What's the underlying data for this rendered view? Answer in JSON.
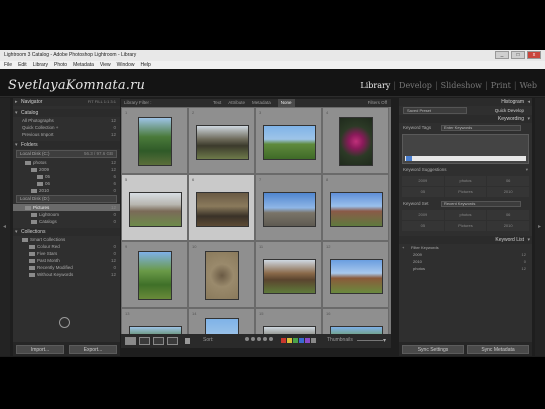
{
  "window": {
    "title": "Lightroom 3 Catalog - Adobe Photoshop Lightroom - Library",
    "controls": [
      "_",
      "□",
      "x"
    ]
  },
  "menu": [
    "File",
    "Edit",
    "Library",
    "Photo",
    "Metadata",
    "View",
    "Window",
    "Help"
  ],
  "identity_plate": "SvetlayaKomnata.ru",
  "modules": [
    "Library",
    "Develop",
    "Slideshow",
    "Print",
    "Web"
  ],
  "left_panel": {
    "navigator": {
      "title": "Navigator",
      "options": "FIT  FILL  1:1  3:1"
    },
    "catalog": {
      "title": "Catalog",
      "items": [
        {
          "label": "All Photographs",
          "count": "12"
        },
        {
          "label": "Quick Collection +",
          "count": "0"
        },
        {
          "label": "Previous Import",
          "count": "12"
        }
      ]
    },
    "folders": {
      "title": "Folders",
      "volume": {
        "label": "Local Disk (C:)",
        "count": "56.3 / 97.6 GB"
      },
      "items": [
        {
          "label": "photos",
          "count": "12"
        },
        {
          "label": "2009",
          "count": "12"
        },
        {
          "label": "05",
          "count": "6"
        },
        {
          "label": "06",
          "count": "6"
        },
        {
          "label": "2010",
          "count": "0"
        }
      ],
      "volume2": {
        "label": "Local Disk (D:)",
        "count": ""
      },
      "items2": [
        {
          "label": "Pictures",
          "count": "12"
        },
        {
          "label": "Lightroom",
          "count": "0"
        },
        {
          "label": "Catalogs",
          "count": "0"
        }
      ]
    },
    "collections": {
      "title": "Collections",
      "items": [
        {
          "label": "Smart Collections",
          "count": ""
        },
        {
          "label": "Colour Red",
          "count": "0"
        },
        {
          "label": "Five Stars",
          "count": "0"
        },
        {
          "label": "Past Month",
          "count": "12"
        },
        {
          "label": "Recently Modified",
          "count": "0"
        },
        {
          "label": "Without Keywords",
          "count": "12"
        }
      ]
    },
    "import_label": "Import...",
    "export_label": "Export..."
  },
  "filter_bar": {
    "label": "Library Filter :",
    "tabs": [
      "Text",
      "Attribute",
      "Metadata",
      "None"
    ],
    "active_tab": "None",
    "preset": "Filters Off"
  },
  "grid": {
    "cells": [
      {
        "num": "1",
        "kind": "ph-forest",
        "orient": "v",
        "selected": false
      },
      {
        "num": "2",
        "kind": "ph-ruin",
        "orient": "h",
        "selected": false
      },
      {
        "num": "3",
        "kind": "ph-field",
        "orient": "h",
        "selected": false
      },
      {
        "num": "4",
        "kind": "ph-flower",
        "orient": "v",
        "selected": false
      },
      {
        "num": "5",
        "kind": "ph-house",
        "orient": "h",
        "selected": true
      },
      {
        "num": "6",
        "kind": "ph-interior",
        "orient": "h",
        "selected": true
      },
      {
        "num": "7",
        "kind": "ph-street",
        "orient": "h",
        "selected": false
      },
      {
        "num": "8",
        "kind": "ph-tower",
        "orient": "h",
        "selected": false
      },
      {
        "num": "9",
        "kind": "ph-tree",
        "orient": "v",
        "selected": false
      },
      {
        "num": "10",
        "kind": "ph-ground",
        "orient": "v",
        "selected": false
      },
      {
        "num": "11",
        "kind": "ph-shed",
        "orient": "h",
        "selected": false
      },
      {
        "num": "12",
        "kind": "ph-barn",
        "orient": "h",
        "selected": false
      },
      {
        "num": "13",
        "kind": "ph-forest",
        "orient": "h",
        "selected": false
      },
      {
        "num": "14",
        "kind": "ph-field",
        "orient": "v",
        "selected": false
      },
      {
        "num": "15",
        "kind": "ph-ruin",
        "orient": "h",
        "selected": false
      },
      {
        "num": "16",
        "kind": "ph-tree",
        "orient": "h",
        "selected": false
      }
    ]
  },
  "toolbar": {
    "sort_label": "Sort:",
    "thumbnails_label": "Thumbnails",
    "swatch_colors": [
      "#c8372d",
      "#d8c03a",
      "#4aa24a",
      "#3a6ad0",
      "#8a4ac8",
      "#888888"
    ]
  },
  "right_panel": {
    "histogram": "Histogram",
    "quick_develop": {
      "title": "Quick Develop",
      "preset": "Saved Preset"
    },
    "keywording": {
      "title": "Keywording",
      "tags_label": "Keyword Tags",
      "tags_mode": "Enter Keywords",
      "suggestions_title": "Keyword Suggestions",
      "suggestions": [
        "2009",
        "photos",
        "06",
        "05",
        "Pictures",
        "2010"
      ],
      "set_label": "Keyword Set",
      "set_value": "Recent Keywords",
      "set_items": [
        "2009",
        "photos",
        "06",
        "05",
        "Pictures",
        "2010"
      ]
    },
    "keyword_list": {
      "title": "Keyword List",
      "filter": "Filter Keywords",
      "items": [
        {
          "label": "2009",
          "count": "12"
        },
        {
          "label": "2010",
          "count": "0"
        },
        {
          "label": "photos",
          "count": "12"
        }
      ]
    },
    "sync_settings_label": "Sync Settings",
    "sync_metadata_label": "Sync Metadata"
  }
}
